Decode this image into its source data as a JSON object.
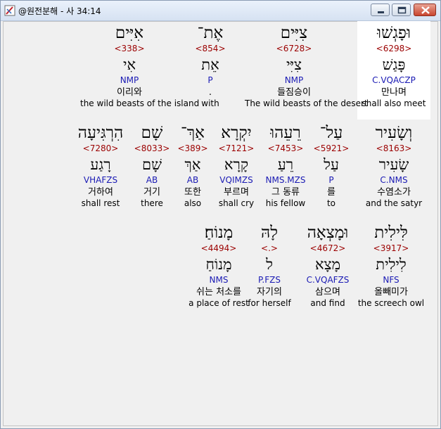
{
  "window": {
    "title": "@원전분해 - 사 34:14"
  },
  "rows": [
    [
      {
        "hebrew": "וּפָגְשׁוּ",
        "strong": "<6298>",
        "lemma": "פָּגַשׁ",
        "morph": "C.VQACZP",
        "korean": "만나며",
        "english": "shall also meet"
      },
      {
        "hebrew": "צִיִּים",
        "strong": "<6728>",
        "lemma": "צִיִּי",
        "morph": "NMP",
        "korean": "들짐승이",
        "english": "The wild beasts of the desert"
      },
      {
        "hebrew": "אֶת־",
        "strong": "<854>",
        "lemma": "אֵת",
        "morph": "P",
        "korean": ".",
        "english": "with"
      },
      {
        "hebrew": "אִיִּים",
        "strong": "<338>",
        "lemma": "אִי",
        "morph": "NMP",
        "korean": "이리와",
        "english": "the wild beasts of the island"
      }
    ],
    [
      {
        "hebrew": "וְשָׂעִיר",
        "strong": "<8163>",
        "lemma": "שָׂעִיר",
        "morph": "C.NMS",
        "korean": "수염소가",
        "english": "and the satyr"
      },
      {
        "hebrew": "עַל־",
        "strong": "<5921>",
        "lemma": "עַל",
        "morph": "P",
        "korean": "를",
        "english": "to"
      },
      {
        "hebrew": "רֵעֵהוּ",
        "strong": "<7453>",
        "lemma": "רֵעַ",
        "morph": "NMS.MZS",
        "korean": "그 동류",
        "english": "his fellow"
      },
      {
        "hebrew": "יִקְרָא",
        "strong": "<7121>",
        "lemma": "קָרָא",
        "morph": "VQIMZS",
        "korean": "부르며",
        "english": "shall cry"
      },
      {
        "hebrew": "אַךְ־",
        "strong": "<389>",
        "lemma": "אַךְ",
        "morph": "AB",
        "korean": "또한",
        "english": "also"
      },
      {
        "hebrew": "שָׁם",
        "strong": "<8033>",
        "lemma": "שָׁם",
        "morph": "AB",
        "korean": "거기",
        "english": "there"
      },
      {
        "hebrew": "הִרְגִּיעָה",
        "strong": "<7280>",
        "lemma": "רָגַע",
        "morph": "VHAFZS",
        "korean": "거하여",
        "english": "shall rest"
      }
    ],
    [
      {
        "hebrew": "לִּילִית",
        "strong": "<3917>",
        "lemma": "לִילִית",
        "morph": "NFS",
        "korean": "올빼미가",
        "english": "the screech owl"
      },
      {
        "hebrew": "וּמָצְאָה",
        "strong": "<4672>",
        "lemma": "מָצָא",
        "morph": "C.VQAFZS",
        "korean": "삼으며",
        "english": "and find"
      },
      {
        "hebrew": "לָהּ",
        "strong": "<.>",
        "lemma": "ל",
        "morph": "P.FZS",
        "korean": "자기의",
        "english": "for herself"
      },
      {
        "hebrew": "מָנוֹחַ׃",
        "strong": "<4494>",
        "lemma": "מָנוֹחַ",
        "morph": "NMS",
        "korean": "쉬는 처소를",
        "english": "a place of rest"
      }
    ]
  ]
}
